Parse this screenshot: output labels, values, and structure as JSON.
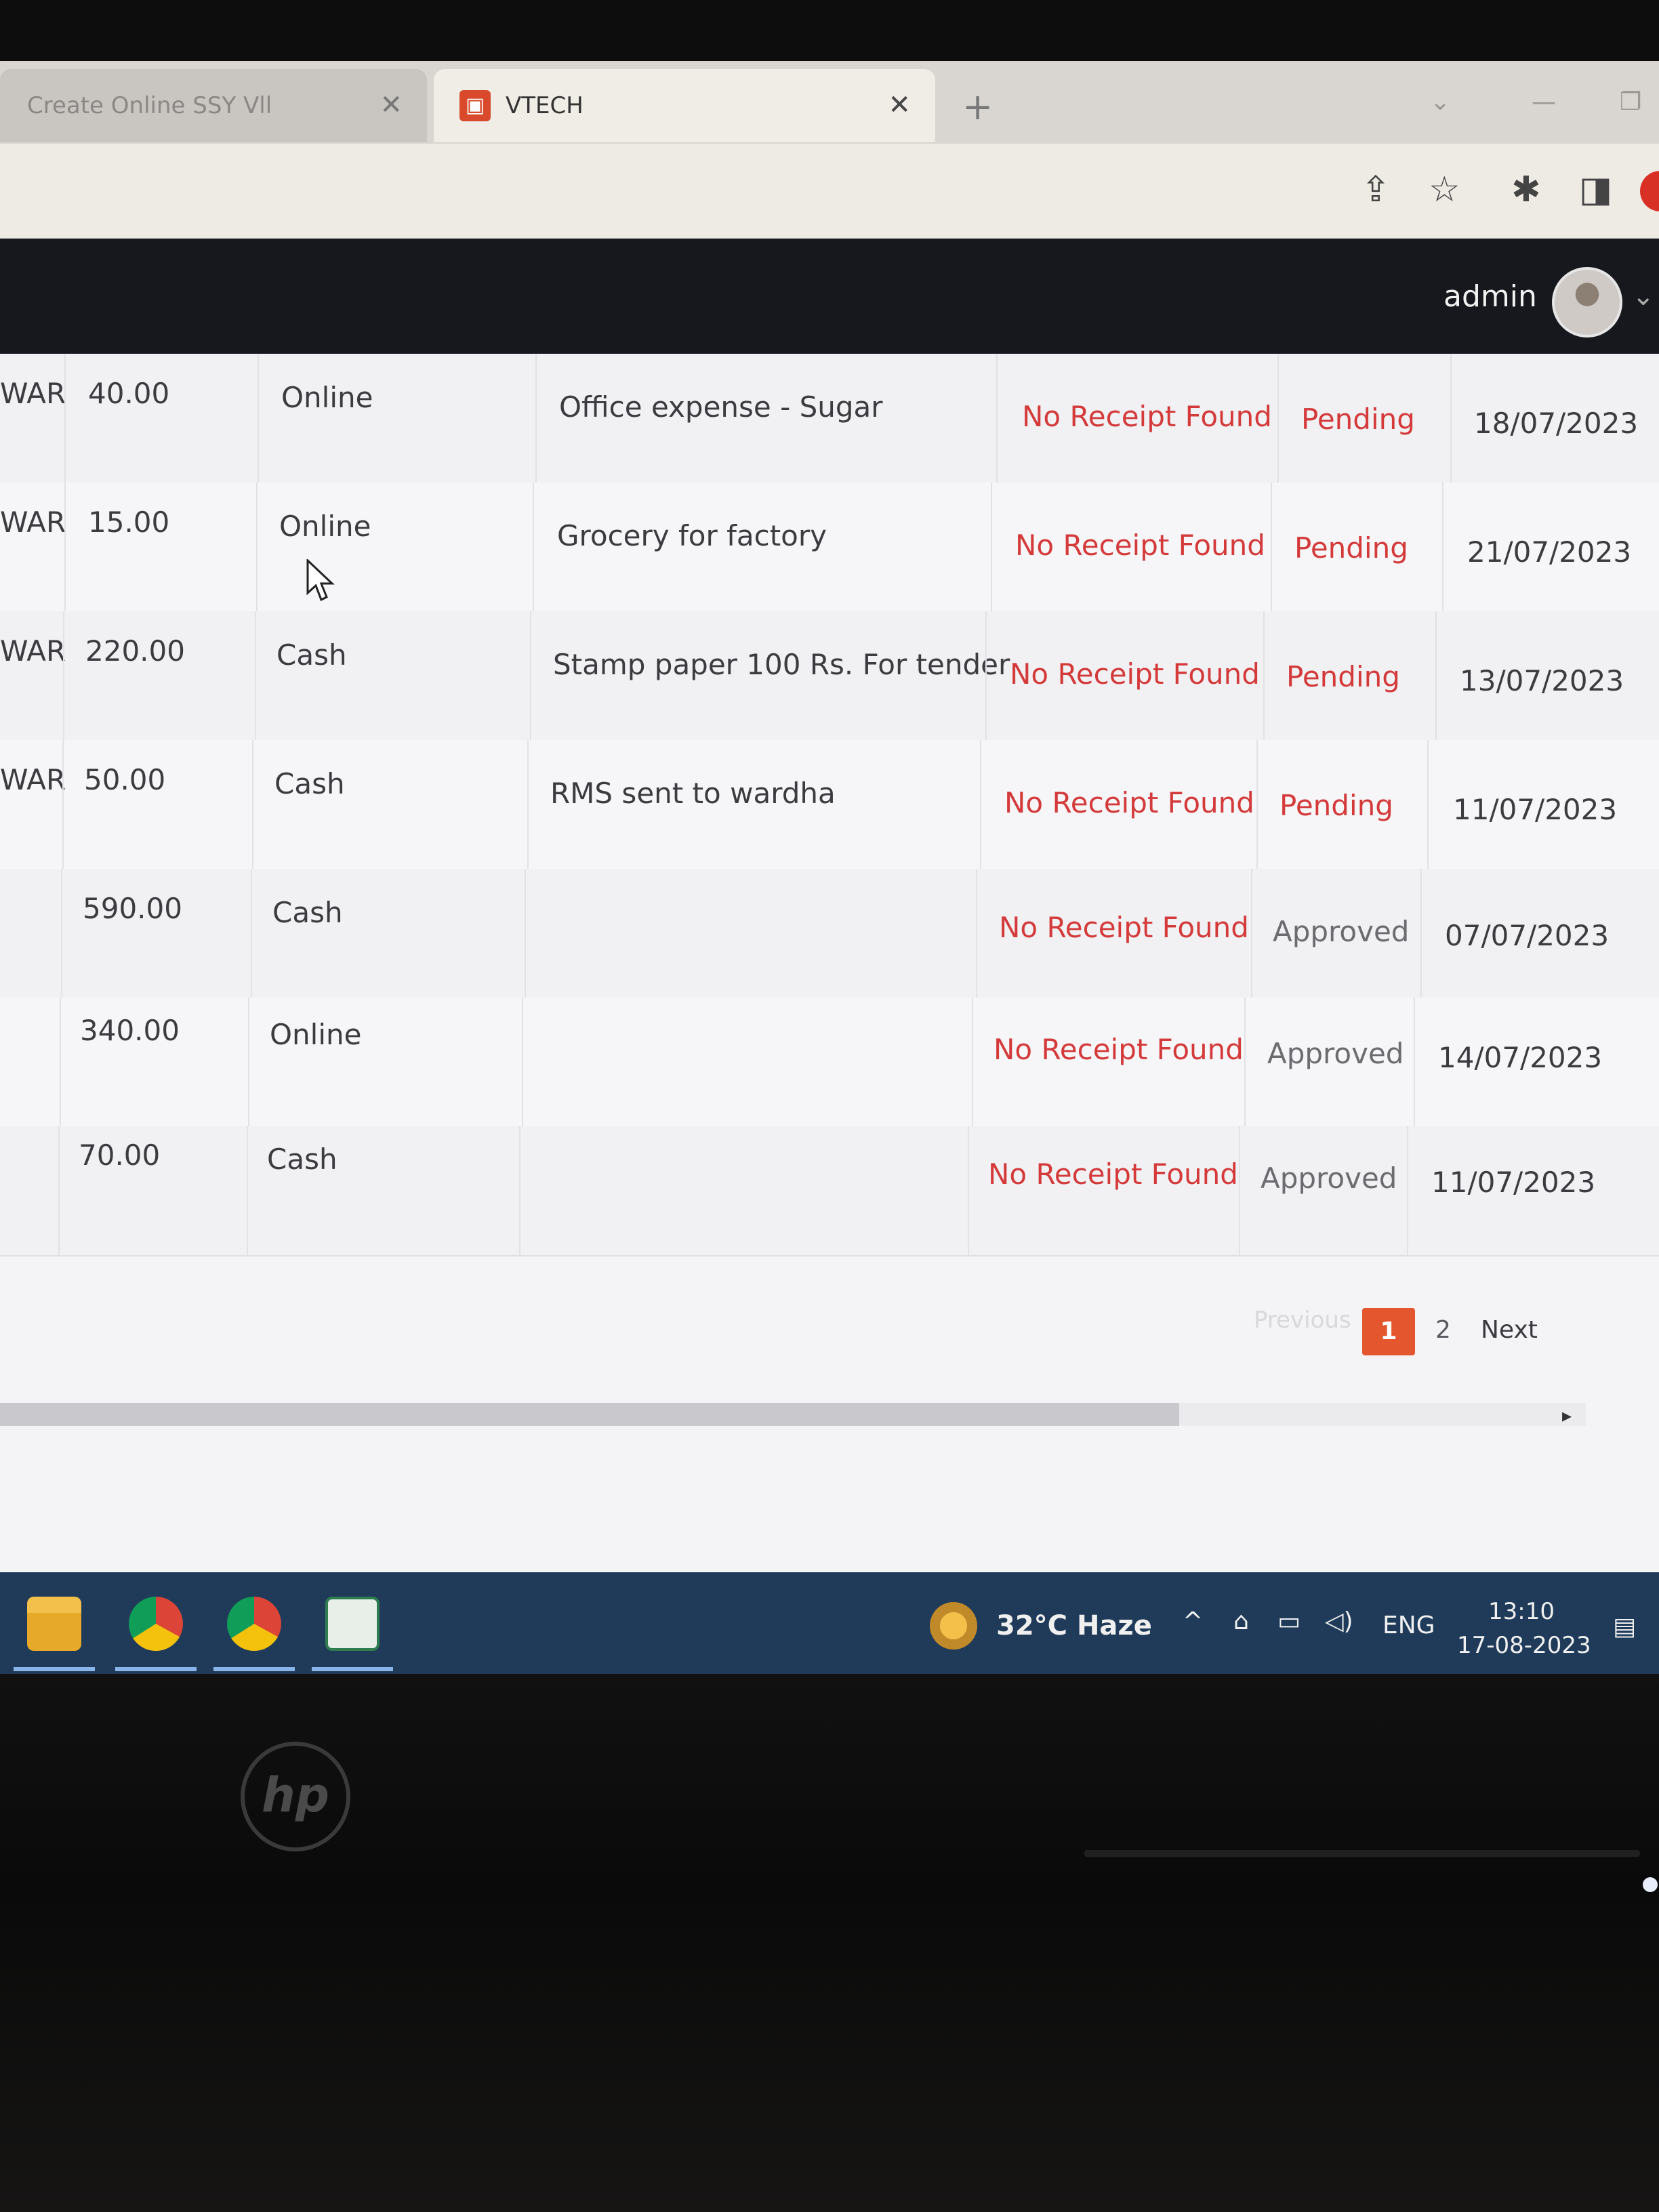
{
  "browser": {
    "tabs": [
      {
        "title": "Create Online SSY Vll",
        "close": "✕"
      },
      {
        "title": "VTECH",
        "close": "✕"
      }
    ],
    "new_tab": "+"
  },
  "header": {
    "user": "admin"
  },
  "table": {
    "rows": [
      {
        "name": "WAR",
        "amount": "40.00",
        "mode": "Online",
        "description": "Office expense - Sugar",
        "receipt": "No Receipt Found",
        "status": "Pending",
        "date": "18/07/2023"
      },
      {
        "name": "WAR",
        "amount": "15.00",
        "mode": "Online",
        "description": "Grocery for factory",
        "receipt": "No Receipt Found",
        "status": "Pending",
        "date": "21/07/2023"
      },
      {
        "name": "WAR",
        "amount": "220.00",
        "mode": "Cash",
        "description": "Stamp paper 100 Rs. For tender",
        "receipt": "No Receipt Found",
        "status": "Pending",
        "date": "13/07/2023"
      },
      {
        "name": "WAR",
        "amount": "50.00",
        "mode": "Cash",
        "description": "RMS sent to wardha",
        "receipt": "No Receipt Found",
        "status": "Pending",
        "date": "11/07/2023"
      },
      {
        "name": "",
        "amount": "590.00",
        "mode": "Cash",
        "description": "",
        "receipt": "No Receipt Found",
        "status": "Approved",
        "date": "07/07/2023"
      },
      {
        "name": "",
        "amount": "340.00",
        "mode": "Online",
        "description": "",
        "receipt": "No Receipt Found",
        "status": "Approved",
        "date": "14/07/2023"
      },
      {
        "name": "",
        "amount": "70.00",
        "mode": "Cash",
        "description": "",
        "receipt": "No Receipt Found",
        "status": "Approved",
        "date": "11/07/2023"
      }
    ]
  },
  "pagination": {
    "previous": "Previous",
    "current": "1",
    "page2": "2",
    "next": "Next"
  },
  "taskbar": {
    "weather": "32°C  Haze",
    "language": "ENG",
    "time": "13:10",
    "date": "17-08-2023"
  },
  "monitor": {
    "brand": "hp"
  },
  "colors": {
    "pending": "#d43a3a",
    "receipt": "#d43a3a",
    "approved": "#6b6b70",
    "pager_active": "#e4572e",
    "header_bg": "#17181d",
    "taskbar_bg": "#1f3b59"
  }
}
